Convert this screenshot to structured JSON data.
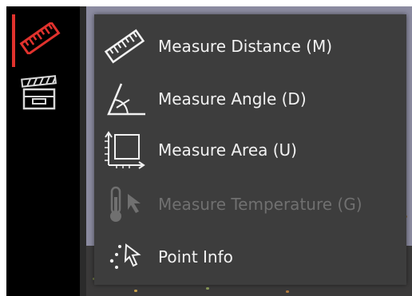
{
  "toolbar": {
    "items": [
      {
        "icon": "ruler-icon",
        "active": true,
        "color": "#e0322d"
      },
      {
        "icon": "clapperboard-icon",
        "active": false,
        "color": "#d8d8d8"
      }
    ]
  },
  "menu": {
    "items": [
      {
        "label": "Measure Distance (M)",
        "icon": "ruler-icon",
        "enabled": true
      },
      {
        "label": "Measure Angle (D)",
        "icon": "angle-icon",
        "enabled": true
      },
      {
        "label": "Measure Area (U)",
        "icon": "area-icon",
        "enabled": true
      },
      {
        "label": "Measure Temperature (G)",
        "icon": "thermometer-icon",
        "enabled": false
      },
      {
        "label": "Point Info",
        "icon": "point-info-icon",
        "enabled": true
      }
    ]
  },
  "colors": {
    "accent": "#e0322d",
    "menu_bg": "#3d3d3d",
    "menu_text": "#f2f2f2",
    "disabled_text": "#707070",
    "toolbar_bg": "#000000"
  }
}
